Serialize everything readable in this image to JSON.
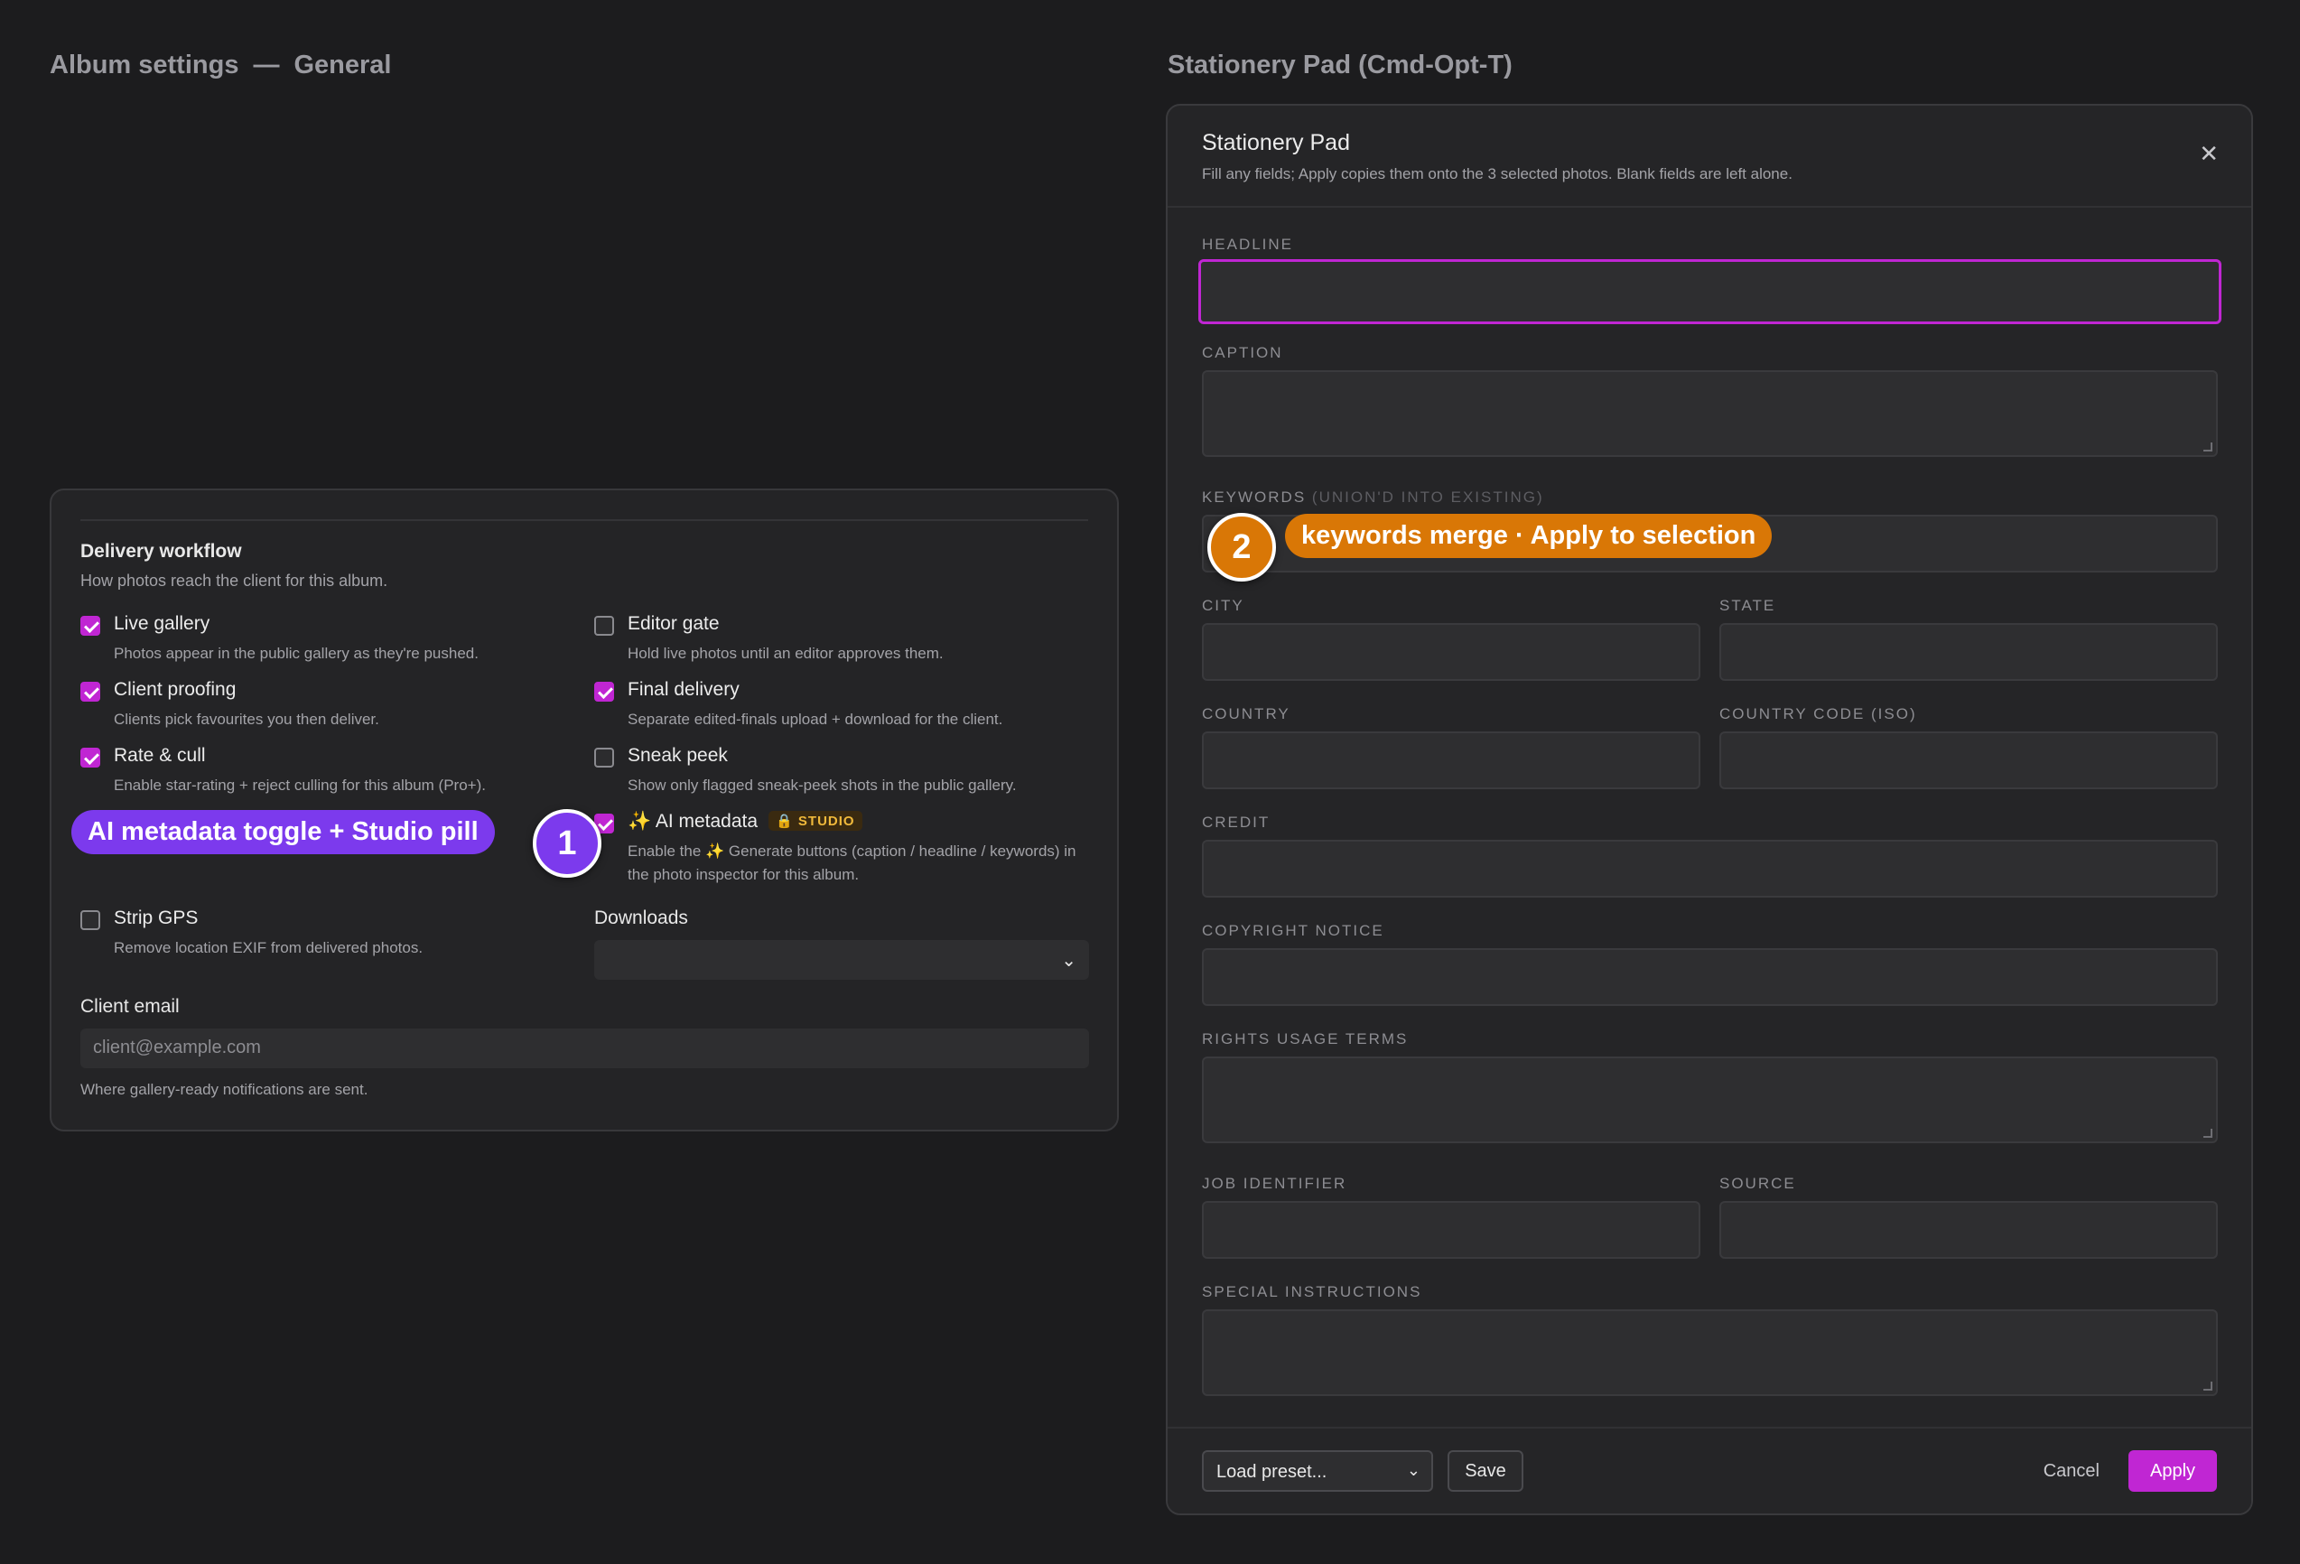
{
  "left_title": {
    "main": "Album settings",
    "dash": "—",
    "section": "General"
  },
  "right_title": "Stationery Pad  (Cmd-Opt-T)",
  "delivery": {
    "heading": "Delivery workflow",
    "subheading": "How photos reach the client for this album.",
    "options": [
      {
        "label": "Live gallery",
        "desc": "Photos appear in the public gallery as they're pushed.",
        "checked": true
      },
      {
        "label": "Editor gate",
        "desc": "Hold live photos until an editor approves them.",
        "checked": false
      },
      {
        "label": "Client proofing",
        "desc": "Clients pick favourites you then deliver.",
        "checked": true
      },
      {
        "label": "Final delivery",
        "desc": "Separate edited-finals upload + download for the client.",
        "checked": true
      },
      {
        "label": "Rate & cull",
        "desc": "Enable star-rating + reject culling for this album (Pro+).",
        "checked": true
      },
      {
        "label": "Sneak peek",
        "desc": "Show only flagged sneak-peek shots in the public gallery.",
        "checked": false
      },
      {
        "label": "✨  AI metadata",
        "desc": "Enable the ✨ Generate buttons (caption / headline / keywords) in the photo inspector for this album.",
        "checked": true,
        "pill": "🔒 STUDIO"
      },
      {
        "label": "Strip GPS",
        "desc": "Remove location EXIF from delivered photos.",
        "checked": false
      }
    ],
    "downloads_label": "Downloads",
    "downloads_value": "",
    "client_email_label": "Client email",
    "client_email_placeholder": "client@example.com",
    "client_email_help": "Where gallery-ready notifications are sent."
  },
  "annotations": {
    "one": {
      "number": "1",
      "text": "AI metadata toggle + Studio pill",
      "color": "#7c3aed"
    },
    "two": {
      "number": "2",
      "text": "keywords merge · Apply to selection",
      "color": "#d97706"
    }
  },
  "modal": {
    "title": "Stationery Pad",
    "subtitle": "Fill any fields; Apply copies them onto the 3 selected photos. Blank fields are left alone.",
    "close": "✕",
    "fields": {
      "headline": "Headline",
      "caption": "Caption",
      "keywords": "Keywords",
      "keywords_hint": "(union'd into existing)",
      "city": "City",
      "state": "State",
      "country": "Country",
      "country_code": "Country code (ISO)",
      "credit": "Credit",
      "copyright": "Copyright notice",
      "rights": "Rights usage terms",
      "job": "Job identifier",
      "source": "Source",
      "special": "Special instructions"
    },
    "footer": {
      "preset": "Load preset...",
      "save": "Save",
      "cancel": "Cancel",
      "apply": "Apply"
    }
  }
}
